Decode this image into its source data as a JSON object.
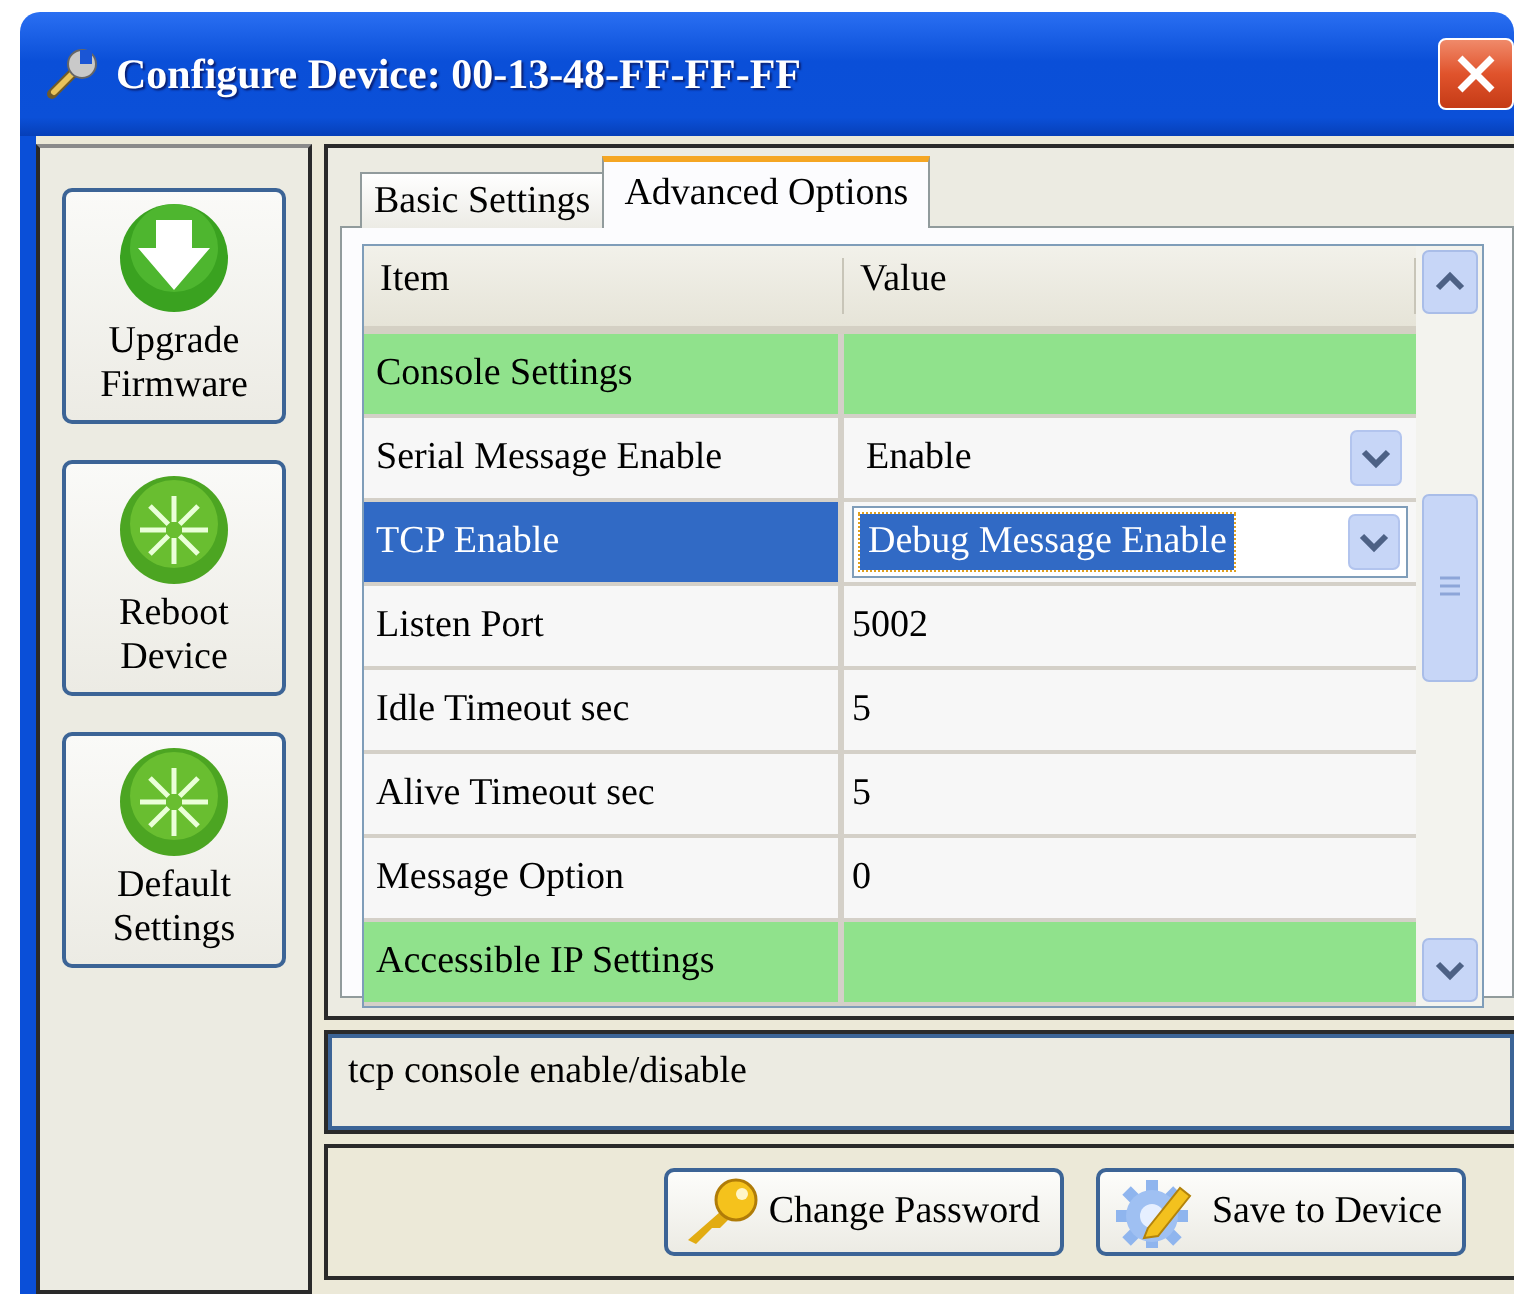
{
  "window": {
    "title": "Configure Device: 00-13-48-FF-FF-FF"
  },
  "side_buttons": [
    {
      "label": "Upgrade Firmware",
      "kind": "download"
    },
    {
      "label": "Reboot Device",
      "kind": "burst"
    },
    {
      "label": "Default Settings",
      "kind": "burst"
    }
  ],
  "tabs": [
    {
      "label": "Basic Settings",
      "selected": false
    },
    {
      "label": "Advanced Options",
      "selected": true
    }
  ],
  "table": {
    "columns": [
      "Item",
      "Value"
    ],
    "rows": [
      {
        "kind": "group",
        "item": "Console Settings",
        "selected": false
      },
      {
        "kind": "dropdown",
        "item": "Serial Message Enable",
        "value": "Enable",
        "selected": false
      },
      {
        "kind": "dropdown",
        "item": "TCP Enable",
        "value": "Debug Message Enable",
        "selected": true
      },
      {
        "kind": "text",
        "item": "Listen Port",
        "value": "5002",
        "selected": false
      },
      {
        "kind": "text",
        "item": "Idle Timeout sec",
        "value": "5",
        "selected": false
      },
      {
        "kind": "text",
        "item": "Alive Timeout sec",
        "value": "5",
        "selected": false
      },
      {
        "kind": "text",
        "item": "Message Option",
        "value": "0",
        "selected": false
      },
      {
        "kind": "group",
        "item": "Accessible IP Settings",
        "selected": false
      }
    ]
  },
  "description": "tcp console enable/disable",
  "buttons": [
    {
      "label": "Change Password",
      "kind": "key"
    },
    {
      "label": "Save to Device",
      "kind": "gear"
    }
  ]
}
